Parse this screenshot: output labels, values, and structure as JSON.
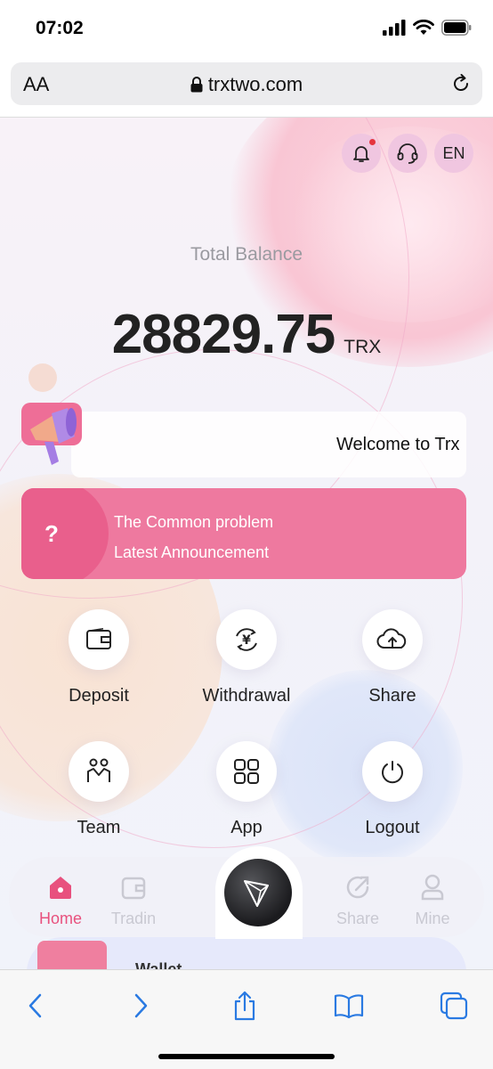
{
  "status_bar": {
    "time": "07:02"
  },
  "browser": {
    "text_size_label": "AA",
    "url": "trxtwo.com"
  },
  "header": {
    "language": "EN"
  },
  "balance": {
    "label": "Total Balance",
    "value": "28829.75",
    "unit": "TRX"
  },
  "notice": {
    "text": "Welcome to Trx"
  },
  "problem_card": {
    "icon_glyph": "?",
    "line1": "The Common problem",
    "line2": "Latest Announcement"
  },
  "actions": [
    {
      "label": "Deposit",
      "icon": "wallet-icon"
    },
    {
      "label": "Withdrawal",
      "icon": "yen-exchange-icon"
    },
    {
      "label": "Share",
      "icon": "cloud-icon"
    },
    {
      "label": "Team",
      "icon": "team-icon"
    },
    {
      "label": "App",
      "icon": "grid-icon"
    },
    {
      "label": "Logout",
      "icon": "power-icon"
    }
  ],
  "tabbar": {
    "items": [
      {
        "label": "Home",
        "icon": "home-icon",
        "active": true
      },
      {
        "label": "Tradin",
        "icon": "trading-wallet-icon",
        "active": false
      },
      {
        "label": "Share",
        "icon": "share-icon",
        "active": false
      },
      {
        "label": "Mine",
        "icon": "user-icon",
        "active": false
      }
    ],
    "center_icon": "tron-logo-icon"
  },
  "bottom_peek": {
    "text": "Wallet"
  },
  "colors": {
    "accent": "#e8517e",
    "card_pink": "#ee799f",
    "badge": "#f0c6e0",
    "notification_dot": "#e5353e",
    "safari_blue": "#2a7ae2"
  }
}
